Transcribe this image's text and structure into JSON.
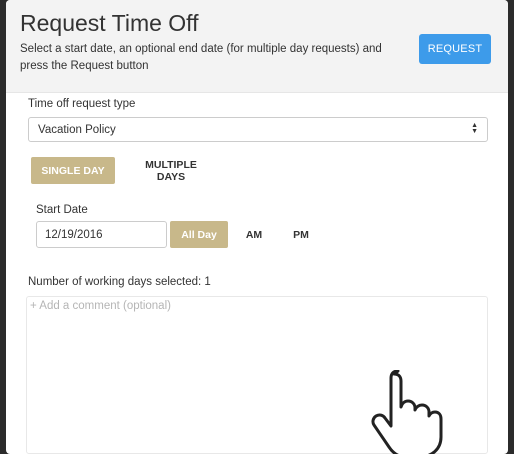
{
  "dialog": {
    "title": "Request Time Off",
    "instructions": "Select a start date, an optional end date (for multiple day requests) and press the Request button",
    "request_label": "REQUEST"
  },
  "type_field": {
    "label": "Time off request type",
    "value": "Vacation Policy"
  },
  "tabs": {
    "single": "SINGLE DAY",
    "multiple": "MULTIPLE DAYS"
  },
  "start_date": {
    "label": "Start Date",
    "value": "12/19/2016"
  },
  "day_part": {
    "all_day": "All Day",
    "am": "AM",
    "pm": "PM"
  },
  "working_days": "Number of working days selected: 1",
  "comment": {
    "placeholder": "+ Add a comment (optional)"
  },
  "colors": {
    "accent_gold": "#c8b88a",
    "primary_blue": "#3d9bea"
  },
  "icons": {
    "cursor": "hand-pointer-icon",
    "select_arrows": "sort-arrows-icon"
  }
}
